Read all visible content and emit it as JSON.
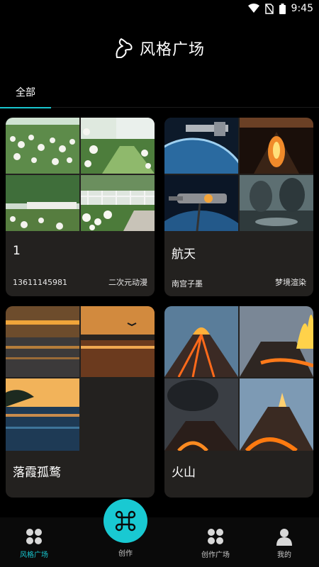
{
  "status": {
    "time": "9:45"
  },
  "header": {
    "title": "风格广场",
    "logo_icon": "horse-logo-icon"
  },
  "tabs": [
    {
      "label": "全部",
      "active": true
    }
  ],
  "cards": [
    {
      "title": "1",
      "author": "13611145981",
      "style": "二次元动漫"
    },
    {
      "title": "航天",
      "author": "南宫子墨",
      "style": "梦境渲染"
    },
    {
      "title": "落霞孤鹜",
      "author": "",
      "style": ""
    },
    {
      "title": "火山",
      "author": "",
      "style": ""
    }
  ],
  "nav": [
    {
      "label": "风格广场",
      "icon": "grid-icon",
      "active": true
    },
    {
      "label": "创作",
      "icon": "command-icon",
      "active": false
    },
    {
      "label": "创作广场",
      "icon": "grid-icon",
      "active": false
    },
    {
      "label": "我的",
      "icon": "user-icon",
      "active": false
    }
  ],
  "colors": {
    "accent": "#18c6cf",
    "card_bg": "#23211f",
    "background": "#000000"
  }
}
